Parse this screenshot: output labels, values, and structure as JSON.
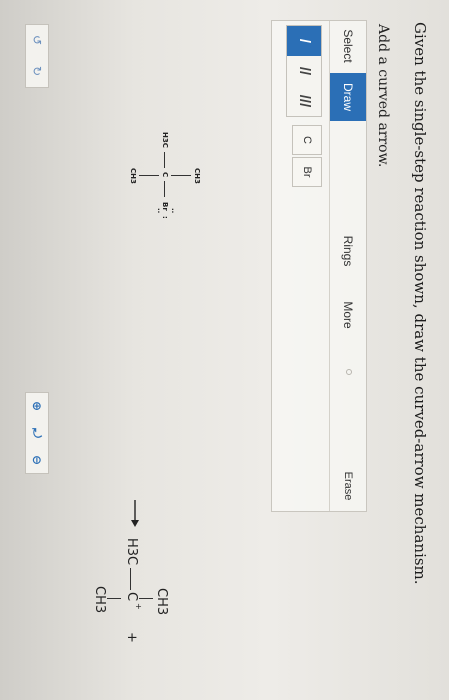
{
  "question": {
    "text": "Given the single-step reaction shown, draw the curved-arrow mechanism."
  },
  "subtitle": "Add a curved arrow.",
  "tabs": {
    "select": "Select",
    "draw": "Draw",
    "rings": "Rings",
    "more": "More",
    "erase": "Erase"
  },
  "bond_tools": {
    "single": "/",
    "double": "//",
    "triple": "///"
  },
  "atoms": {
    "carbon": "C",
    "bromine": "Br"
  },
  "history": {
    "undo": "↺",
    "redo": "↻"
  },
  "zoom": {
    "zoom_in": "⊕",
    "reset": "⤾",
    "zoom_out": "⊖"
  },
  "reactant": {
    "top": "CH3",
    "left": "H3C",
    "center": "C",
    "right": "Br",
    "lone_pair_top": "··",
    "lone_pair_right": ":",
    "lone_pair_bottom": "··",
    "bottom": "CH3"
  },
  "product": {
    "top": "CH3",
    "left": "H3C",
    "center": "C",
    "charge": "+",
    "bottom": "CH3",
    "plus": "+"
  },
  "colors": {
    "accent": "#2b6fb6",
    "icon": "#6a8fbd"
  }
}
